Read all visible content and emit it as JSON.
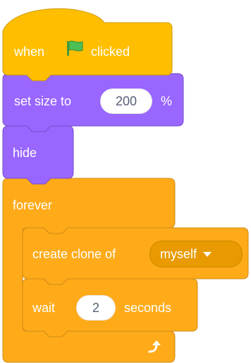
{
  "script": {
    "hat_block": {
      "prefix": "when",
      "icon": "green-flag-icon",
      "suffix": "clicked",
      "color": "#ffbf00"
    },
    "set_size_block": {
      "prefix": "set size to",
      "value": "200",
      "suffix": "%",
      "color": "#9966ff"
    },
    "hide_block": {
      "label": "hide",
      "color": "#9966ff"
    },
    "forever_block": {
      "label": "forever",
      "color": "#ffab19",
      "loop_icon": "loop-arrow-icon"
    },
    "create_clone_block": {
      "prefix": "create clone of",
      "option": "myself",
      "color": "#ffab19"
    },
    "wait_block": {
      "prefix": "wait",
      "value": "2",
      "suffix": "seconds",
      "color": "#ffab19"
    }
  }
}
